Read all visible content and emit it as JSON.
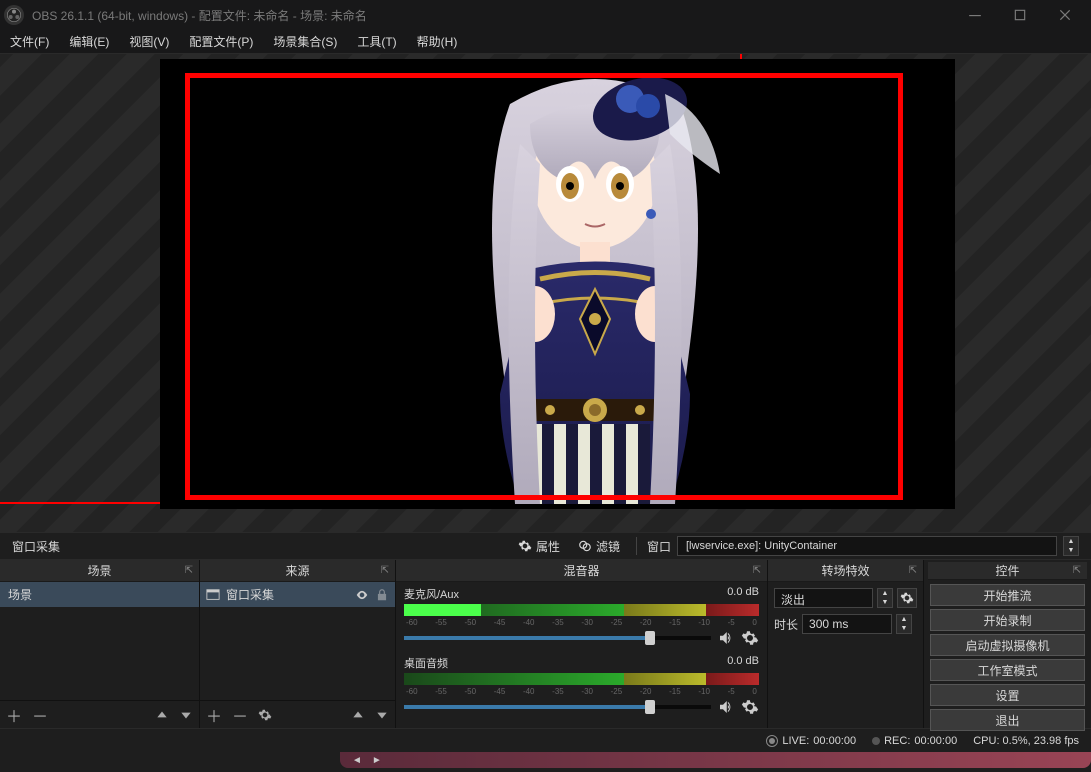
{
  "title": "OBS 26.1.1 (64-bit, windows) - 配置文件: 未命名 - 场景: 未命名",
  "menu": [
    "文件(F)",
    "编辑(E)",
    "视图(V)",
    "配置文件(P)",
    "场景集合(S)",
    "工具(T)",
    "帮助(H)"
  ],
  "toolbar": {
    "label": "窗口采集",
    "properties": "属性",
    "filters": "滤镜",
    "window_label": "窗口",
    "window_value": "[lwservice.exe]: UnityContainer"
  },
  "panels": {
    "scenes": {
      "title": "场景",
      "items": [
        "场景"
      ]
    },
    "sources": {
      "title": "来源",
      "items": [
        {
          "name": "窗口采集"
        }
      ]
    },
    "mixer": {
      "title": "混音器",
      "channels": [
        {
          "name": "麦克风/Aux",
          "db": "0.0 dB",
          "ticks": [
            "-60",
            "-55",
            "-50",
            "-45",
            "-40",
            "-35",
            "-30",
            "-25",
            "-20",
            "-15",
            "-10",
            "-5",
            "0"
          ],
          "level": 0.35
        },
        {
          "name": "桌面音频",
          "db": "0.0 dB",
          "ticks": [
            "-60",
            "-55",
            "-50",
            "-45",
            "-40",
            "-35",
            "-30",
            "-25",
            "-20",
            "-15",
            "-10",
            "-5",
            "0"
          ],
          "level": 0
        }
      ]
    },
    "transitions": {
      "title": "转场特效",
      "selected": "淡出",
      "duration_label": "时长",
      "duration_value": "300 ms"
    },
    "controls": {
      "title": "控件",
      "buttons": [
        "开始推流",
        "开始录制",
        "启动虚拟摄像机",
        "工作室模式",
        "设置",
        "退出"
      ]
    }
  },
  "status": {
    "live_label": "LIVE:",
    "live_time": "00:00:00",
    "rec_label": "REC:",
    "rec_time": "00:00:00",
    "cpu": "CPU: 0.5%, 23.98 fps"
  }
}
